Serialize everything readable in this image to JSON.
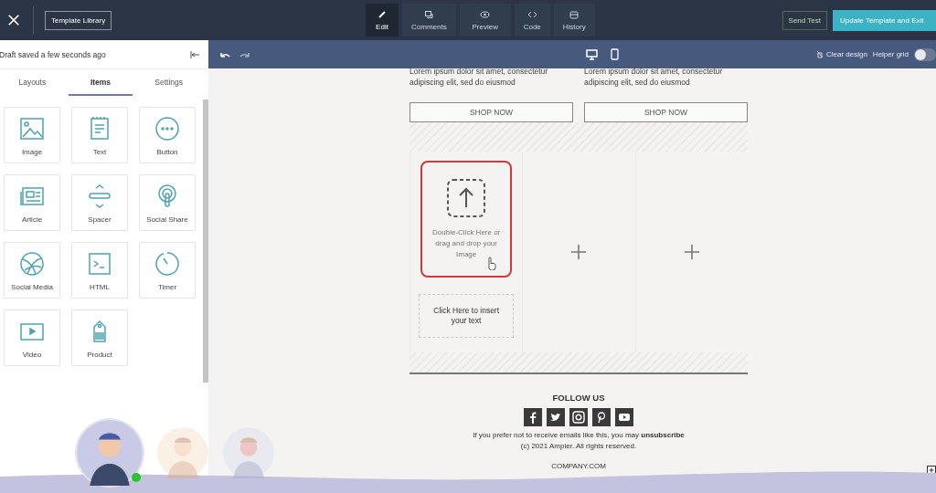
{
  "topbar": {
    "library_button": "Template Library",
    "tabs": [
      {
        "label": "Edit",
        "selected": true
      },
      {
        "label": "Comments",
        "selected": false
      },
      {
        "label": "Preview",
        "selected": false
      },
      {
        "label": "Code",
        "selected": false
      },
      {
        "label": "History",
        "selected": false
      }
    ],
    "send_test": "Send Test",
    "update_button": "Update Template and Exit"
  },
  "sidebar": {
    "status": "Draft saved a few seconds ago",
    "tabs": [
      {
        "label": "Layouts",
        "selected": false
      },
      {
        "label": "Items",
        "selected": true
      },
      {
        "label": "Settings",
        "selected": false
      }
    ],
    "items": [
      {
        "label": "Image"
      },
      {
        "label": "Text"
      },
      {
        "label": "Button"
      },
      {
        "label": "Article"
      },
      {
        "label": "Spacer"
      },
      {
        "label": "Social Share"
      },
      {
        "label": "Social Media"
      },
      {
        "label": "HTML"
      },
      {
        "label": "Timer"
      },
      {
        "label": "Video"
      },
      {
        "label": "Product"
      }
    ]
  },
  "canvas_toolbar": {
    "clear_design": "Clear design",
    "helper_grid": {
      "label": "Helper grid",
      "on": false
    }
  },
  "email": {
    "products": [
      {
        "text": "Lorem ipsum dolor sit amet, consectetur adipiscing elit, sed do eiusmod",
        "button": "SHOP NOW"
      },
      {
        "text": "Lorem ipsum dolor sit amet, consectetur adipiscing elit, sed do eiusmod",
        "button": "SHOP NOW"
      }
    ],
    "image_placeholder": {
      "text": "Double-Click Here or drag and drop your Image",
      "selected": true
    },
    "text_placeholder": "Click Here to insert your text",
    "footer": {
      "heading": "FOLLOW US",
      "unsubscribe": "If you prefer not to receive emails like this, you may **unsubscribe**",
      "copyright": "(c) 2021 Ampier. All rights reserved.",
      "company": "COMPANY.COM"
    }
  },
  "collaborators": [
    {
      "online": true,
      "active": true
    },
    {
      "online": false,
      "active": false
    },
    {
      "online": false,
      "active": false
    }
  ]
}
